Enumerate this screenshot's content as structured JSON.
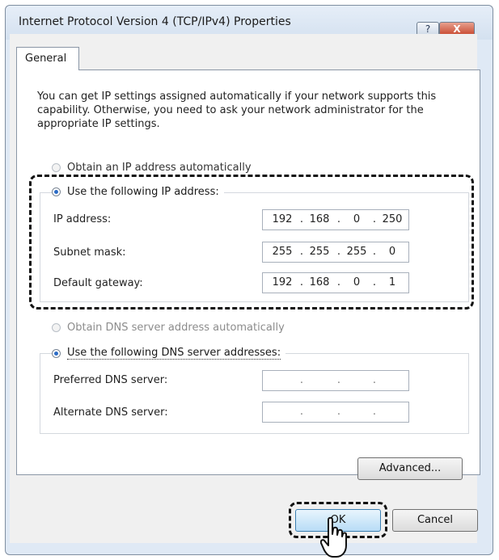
{
  "window": {
    "title": "Internet Protocol Version 4 (TCP/IPv4) Properties",
    "help_button": "?",
    "close_button": "X"
  },
  "tabs": [
    {
      "label": "General"
    }
  ],
  "description": "You can get IP settings assigned automatically if your network supports this capability. Otherwise, you need to ask your network administrator for the appropriate IP settings.",
  "ip_section": {
    "auto_option": {
      "label": "Obtain an IP address automatically",
      "selected": false
    },
    "manual_option": {
      "label": "Use the following IP address:",
      "selected": true
    },
    "fields": [
      {
        "label": "IP address:",
        "octets": [
          "192",
          "168",
          "0",
          "250"
        ]
      },
      {
        "label": "Subnet mask:",
        "octets": [
          "255",
          "255",
          "255",
          "0"
        ]
      },
      {
        "label": "Default gateway:",
        "octets": [
          "192",
          "168",
          "0",
          "1"
        ]
      }
    ]
  },
  "dns_section": {
    "auto_option": {
      "label": "Obtain DNS server address automatically",
      "selected": false,
      "disabled": true
    },
    "manual_option": {
      "label": "Use the following DNS server addresses:",
      "selected": true
    },
    "fields": [
      {
        "label": "Preferred DNS server:",
        "octets": [
          "",
          "",
          "",
          ""
        ]
      },
      {
        "label": "Alternate DNS server:",
        "octets": [
          "",
          "",
          "",
          ""
        ]
      }
    ]
  },
  "buttons": {
    "advanced": "Advanced...",
    "ok": "OK",
    "cancel": "Cancel"
  },
  "icons": {
    "cursor": "hand-pointer-icon",
    "help": "help-icon",
    "close": "close-icon"
  },
  "colors": {
    "titlebar": "#dfe9f5",
    "close_button": "#c6452b",
    "radio_selected": "#2c6cc6",
    "ok_button": "#b7dcf6"
  }
}
